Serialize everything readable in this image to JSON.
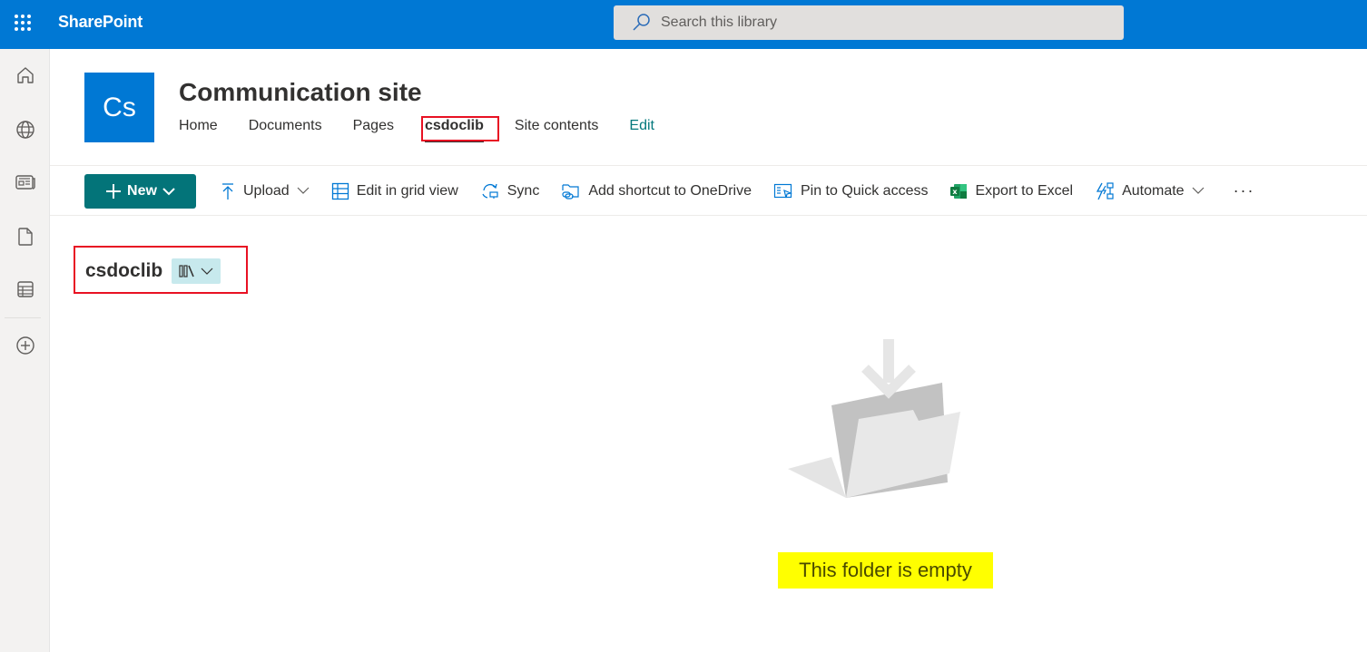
{
  "suite_bar": {
    "app_name": "SharePoint",
    "app_launcher_icon": "waffle-icon",
    "search": {
      "placeholder": "Search this library",
      "value": ""
    },
    "brand_color": "#0078d4"
  },
  "left_nav": {
    "items": [
      {
        "name": "home",
        "icon": "home-icon"
      },
      {
        "name": "sites",
        "icon": "globe-icon"
      },
      {
        "name": "news",
        "icon": "news-icon"
      },
      {
        "name": "files",
        "icon": "document-icon"
      },
      {
        "name": "lists",
        "icon": "list-icon"
      },
      {
        "name": "create",
        "icon": "add-circle-icon"
      }
    ]
  },
  "site": {
    "logo_initials": "Cs",
    "title": "Communication site",
    "nav": [
      {
        "label": "Home",
        "active": false
      },
      {
        "label": "Documents",
        "active": false
      },
      {
        "label": "Pages",
        "active": false
      },
      {
        "label": "csdoclib",
        "active": true
      },
      {
        "label": "Site contents",
        "active": false
      },
      {
        "label": "Edit",
        "active": false
      }
    ]
  },
  "command_bar": {
    "new_label": "New",
    "accent": "#037479",
    "commands": [
      {
        "label": "Upload",
        "icon": "upload-icon",
        "has_dropdown": true
      },
      {
        "label": "Edit in grid view",
        "icon": "grid-icon",
        "has_dropdown": false
      },
      {
        "label": "Sync",
        "icon": "sync-icon",
        "has_dropdown": false
      },
      {
        "label": "Add shortcut to OneDrive",
        "icon": "shortcut-icon",
        "has_dropdown": false
      },
      {
        "label": "Pin to Quick access",
        "icon": "pin-icon",
        "has_dropdown": false
      },
      {
        "label": "Export to Excel",
        "icon": "excel-icon",
        "has_dropdown": false
      },
      {
        "label": "Automate",
        "icon": "automate-icon",
        "has_dropdown": true
      }
    ],
    "more_label": "···"
  },
  "library": {
    "title": "csdoclib",
    "view_switcher_icon": "library-icon"
  },
  "empty_state": {
    "message": "This folder is empty",
    "illustration": "empty-folder-illustration"
  },
  "annotations": {
    "highlight_color": "#e81123",
    "message_highlight": "#ffff00"
  }
}
